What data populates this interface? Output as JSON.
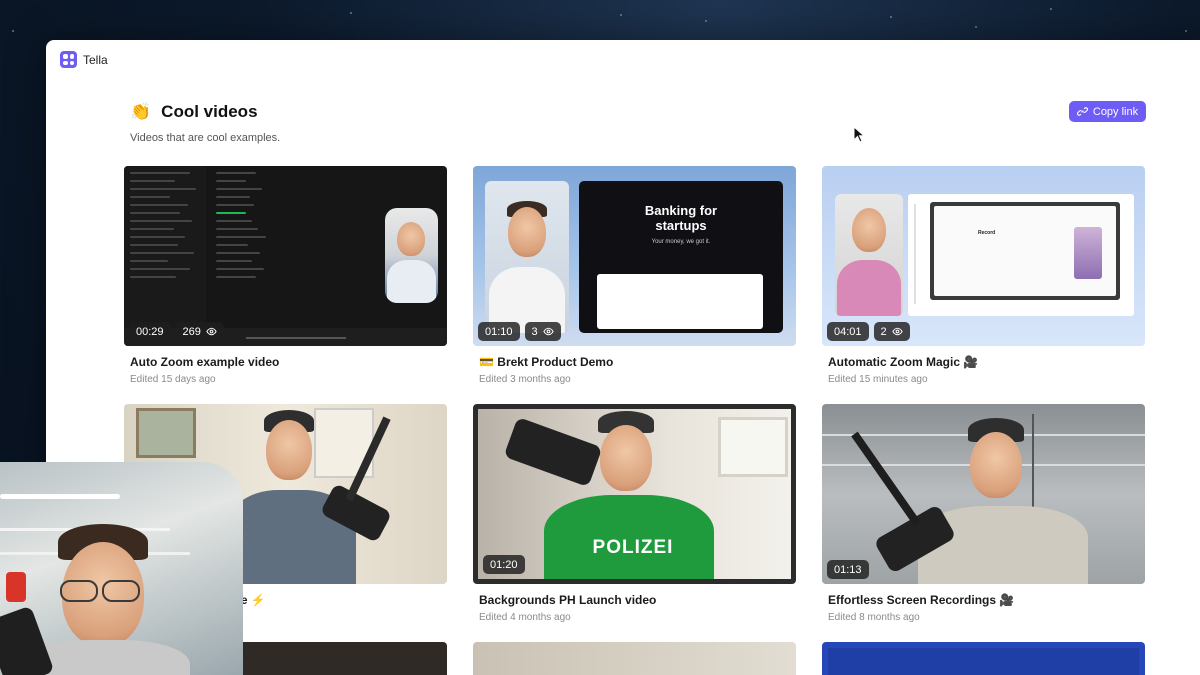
{
  "app": {
    "name": "Tella"
  },
  "header": {
    "emoji": "👏",
    "title": "Cool videos",
    "subtitle": "Videos that are cool examples.",
    "copy_link_label": "Copy link"
  },
  "colors": {
    "accent": "#6d5cf6",
    "badge_bg": "#1e1e1e"
  },
  "videos": [
    {
      "title": "Auto Zoom example video",
      "meta": "Edited 15 days ago",
      "duration": "00:29",
      "views": "269"
    },
    {
      "title": "💳 Brekt Product Demo",
      "meta": "Edited 3 months ago",
      "duration": "01:10",
      "views": "3",
      "thumb_heading": "Banking for startups",
      "thumb_sub": "Your money, we got it."
    },
    {
      "title": "Automatic Zoom Magic 🎥",
      "meta": "Edited 15 minutes ago",
      "duration": "04:01",
      "views": "2",
      "thumb_heading": "Record"
    },
    {
      "title": "eo in About a Minute ⚡",
      "meta": "",
      "duration": "",
      "views": ""
    },
    {
      "title": "Backgrounds PH Launch video",
      "meta": "Edited 4 months ago",
      "duration": "01:20",
      "views": "",
      "shirt_text": "POLIZEI"
    },
    {
      "title": "Effortless Screen Recordings 🎥",
      "meta": "Edited 8 months ago",
      "duration": "01:13",
      "views": ""
    }
  ],
  "icons": {
    "copy": "link-icon",
    "views": "eye-icon",
    "cursor": "mouse-pointer-icon"
  }
}
